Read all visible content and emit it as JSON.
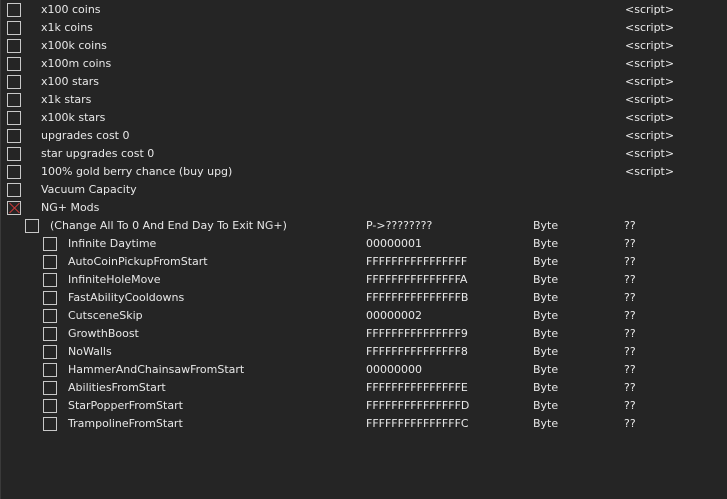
{
  "rows": [
    {
      "level": 0,
      "checked": false,
      "description": "x100 coins",
      "address": "",
      "type": "",
      "value": "<script>"
    },
    {
      "level": 0,
      "checked": false,
      "description": "x1k coins",
      "address": "",
      "type": "",
      "value": "<script>"
    },
    {
      "level": 0,
      "checked": false,
      "description": "x100k coins",
      "address": "",
      "type": "",
      "value": "<script>"
    },
    {
      "level": 0,
      "checked": false,
      "description": "x100m coins",
      "address": "",
      "type": "",
      "value": "<script>"
    },
    {
      "level": 0,
      "checked": false,
      "description": "x100 stars",
      "address": "",
      "type": "",
      "value": "<script>"
    },
    {
      "level": 0,
      "checked": false,
      "description": "x1k stars",
      "address": "",
      "type": "",
      "value": "<script>"
    },
    {
      "level": 0,
      "checked": false,
      "description": "x100k stars",
      "address": "",
      "type": "",
      "value": "<script>"
    },
    {
      "level": 0,
      "checked": false,
      "description": "upgrades cost 0",
      "address": "",
      "type": "",
      "value": "<script>"
    },
    {
      "level": 0,
      "checked": false,
      "description": "star upgrades cost 0",
      "address": "",
      "type": "",
      "value": "<script>"
    },
    {
      "level": 0,
      "checked": false,
      "description": "100% gold berry chance (buy upg)",
      "address": "",
      "type": "",
      "value": "<script>"
    },
    {
      "level": 0,
      "checked": false,
      "description": "Vacuum Capacity",
      "address": "",
      "type": "",
      "value": ""
    },
    {
      "level": 0,
      "checked": true,
      "description": "NG+ Mods",
      "address": "",
      "type": "",
      "value": ""
    },
    {
      "level": 1,
      "checked": false,
      "description": "(Change All To 0 And End Day To Exit NG+)",
      "address": "P->????????",
      "type": "Byte",
      "value": "??"
    },
    {
      "level": 2,
      "checked": false,
      "description": "Infinite Daytime",
      "address": "00000001",
      "type": "Byte",
      "value": "??"
    },
    {
      "level": 2,
      "checked": false,
      "description": "AutoCoinPickupFromStart",
      "address": "FFFFFFFFFFFFFFFF",
      "type": "Byte",
      "value": "??"
    },
    {
      "level": 2,
      "checked": false,
      "description": "InfiniteHoleMove",
      "address": "FFFFFFFFFFFFFFFA",
      "type": "Byte",
      "value": "??"
    },
    {
      "level": 2,
      "checked": false,
      "description": "FastAbilityCooldowns",
      "address": "FFFFFFFFFFFFFFFB",
      "type": "Byte",
      "value": "??"
    },
    {
      "level": 2,
      "checked": false,
      "description": "CutsceneSkip",
      "address": "00000002",
      "type": "Byte",
      "value": "??"
    },
    {
      "level": 2,
      "checked": false,
      "description": "GrowthBoost",
      "address": "FFFFFFFFFFFFFFF9",
      "type": "Byte",
      "value": "??"
    },
    {
      "level": 2,
      "checked": false,
      "description": "NoWalls",
      "address": "FFFFFFFFFFFFFFF8",
      "type": "Byte",
      "value": "??"
    },
    {
      "level": 2,
      "checked": false,
      "description": "HammerAndChainsawFromStart",
      "address": "00000000",
      "type": "Byte",
      "value": "??"
    },
    {
      "level": 2,
      "checked": false,
      "description": "AbilitiesFromStart",
      "address": "FFFFFFFFFFFFFFFE",
      "type": "Byte",
      "value": "??"
    },
    {
      "level": 2,
      "checked": false,
      "description": "StarPopperFromStart",
      "address": "FFFFFFFFFFFFFFFD",
      "type": "Byte",
      "value": "??"
    },
    {
      "level": 2,
      "checked": false,
      "description": "TrampolineFromStart",
      "address": "FFFFFFFFFFFFFFFC",
      "type": "Byte",
      "value": "??"
    }
  ]
}
